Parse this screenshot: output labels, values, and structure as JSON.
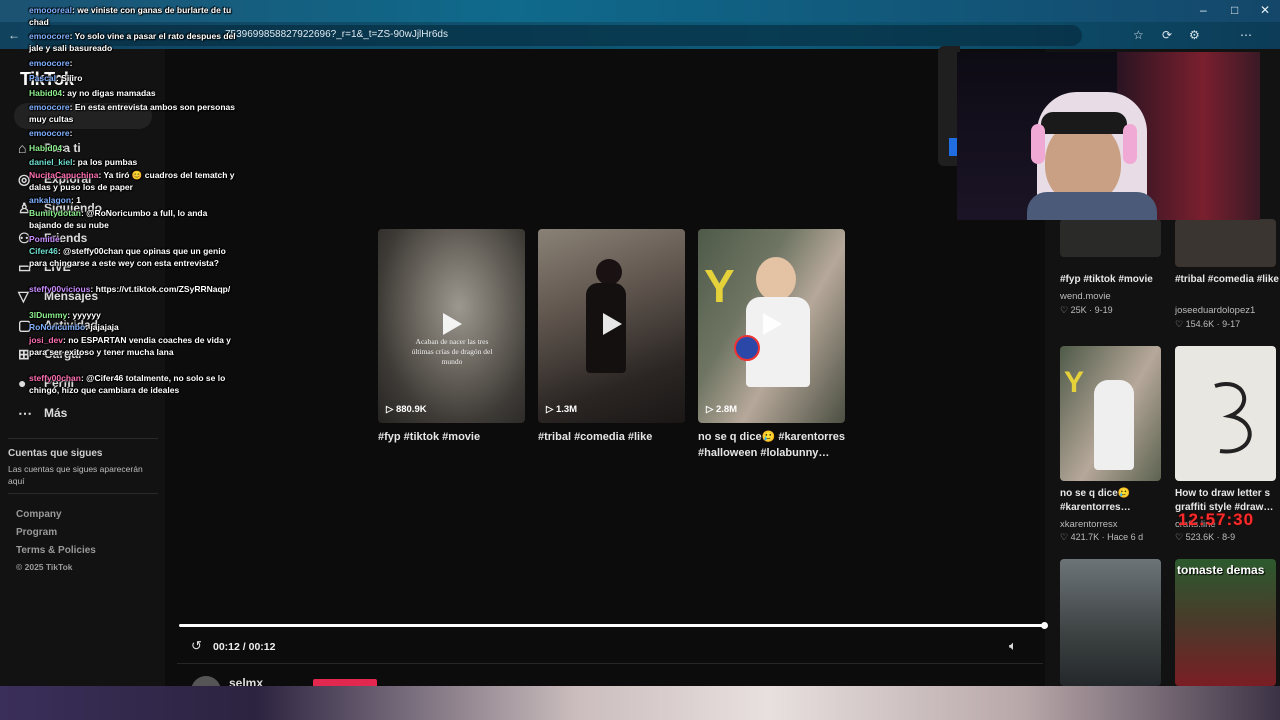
{
  "browser": {
    "url": "7539699858827922696?_r=1&_t=ZS-90wJjlHr6ds",
    "window_controls": [
      "–",
      "□",
      "✕"
    ]
  },
  "sidebar": {
    "logo": "TikTok",
    "search_placeholder": "Buscar",
    "items": [
      {
        "label": "Para ti",
        "icon": "home-icon"
      },
      {
        "label": "Explorar",
        "icon": "compass-icon"
      },
      {
        "label": "Siguiendo",
        "icon": "following-icon"
      },
      {
        "label": "Friends",
        "icon": "friends-icon"
      },
      {
        "label": "LIVE",
        "icon": "live-icon"
      },
      {
        "label": "Mensajes",
        "icon": "messages-icon"
      },
      {
        "label": "Actividad",
        "icon": "inbox-icon"
      },
      {
        "label": "Cargar",
        "icon": "upload-icon"
      },
      {
        "label": "Perfil",
        "icon": "profile-icon"
      },
      {
        "label": "Más",
        "icon": "more-icon"
      }
    ],
    "following_heading": "Cuentas que sigues",
    "following_text": "Las cuentas que sigues aparecerán aquí",
    "footer": [
      "Company",
      "Program",
      "Terms & Policies"
    ],
    "copyright": "© 2025 TikTok"
  },
  "cards": [
    {
      "title": "#fyp #tiktok #movie",
      "views": "880.9K",
      "caption": "Acaban de nacer las tres últimas crías de dragón del mundo"
    },
    {
      "title": "#tribal #comedia #like",
      "views": "1.3M",
      "caption": ""
    },
    {
      "title": "no se q dice🥲 #karentorres #halloween #lolabunny…",
      "views": "2.8M",
      "caption": ""
    }
  ],
  "player": {
    "time": "00:12 / 00:12",
    "progress": 1.0,
    "author": "selmx"
  },
  "related": [
    {
      "title": "#fyp #tiktok #movie",
      "user": "wend.movie",
      "likes": "25K",
      "date": "9-19"
    },
    {
      "title": "#tribal #comedia #like",
      "user": "joseeduardolopez1",
      "likes": "154.6K",
      "date": "9-17"
    },
    {
      "title": "no se q dice🥲 #karentorres…",
      "user": "xkarentorresx",
      "likes": "421.7K",
      "date": "Hace 6 d"
    },
    {
      "title": "How to draw letter s graffiti style #draw…",
      "user": "crafts.line",
      "likes": "523.6K",
      "date": "8-9"
    },
    {
      "title": "",
      "user": "",
      "likes": "",
      "date": ""
    },
    {
      "title": "tomaste demas",
      "user": "",
      "likes": "",
      "date": ""
    }
  ],
  "timer": "12:57:30",
  "chat": [
    {
      "user": "emoooreal",
      "text": "we viniste con ganas de burlarte de tu chad",
      "color": "blue"
    },
    {
      "user": "emoocore",
      "text": "Yo solo vine a pasar el rato despues del jale y sali basureado",
      "color": "blue"
    },
    {
      "user": "emoocore",
      "text": "",
      "color": "blue"
    },
    {
      "user": "Pascal",
      "text": "Siiiro",
      "color": "blue"
    },
    {
      "user": "Habid04",
      "text": "ay no digas mamadas",
      "color": "green"
    },
    {
      "user": "emoocore",
      "text": "En esta entrevista ambos son personas muy cultas",
      "color": "blue"
    },
    {
      "user": "emoocore",
      "text": "",
      "color": "blue"
    },
    {
      "user": "Habid04",
      "text": "",
      "color": "green"
    },
    {
      "user": "daniel_kiel",
      "text": "pa los pumbas",
      "color": "teal"
    },
    {
      "user": "NucitaCapuchina",
      "text": "Ya tiró 😊 cuadros del tematch y dalas y puso los de paper",
      "color": "pink"
    },
    {
      "user": "ankalagon",
      "text": "1",
      "color": "blue"
    },
    {
      "user": "Bumitydotan",
      "text": "@RoNoricumbo a full, lo anda bajando de su nube",
      "color": "green"
    },
    {
      "user": "Pomitie",
      "text": "",
      "color": "purple"
    },
    {
      "user": "Cifer46",
      "text": "@steffy00chan que opinas que un genio para chingarse a este wey con esta entrevista?",
      "color": "teal"
    },
    {
      "user": "steffy00vicious",
      "text": "https://vt.tiktok.com/ZSyRRNaqp/",
      "color": "purple"
    },
    {
      "user": "3lDummy",
      "text": "yyyyyy",
      "color": "green"
    },
    {
      "user": "RoNoricumbo",
      "text": "jajajaja",
      "color": "blue"
    },
    {
      "user": "josi_dev",
      "text": "no ESPARTAN vendia coaches de vida y para ser exitoso y tener mucha lana",
      "color": "pink"
    },
    {
      "user": "steffy00chan",
      "text": "@Cifer46 totalmente, no solo se lo chingó, hizo que cambiara de ideales",
      "color": "pink"
    }
  ]
}
